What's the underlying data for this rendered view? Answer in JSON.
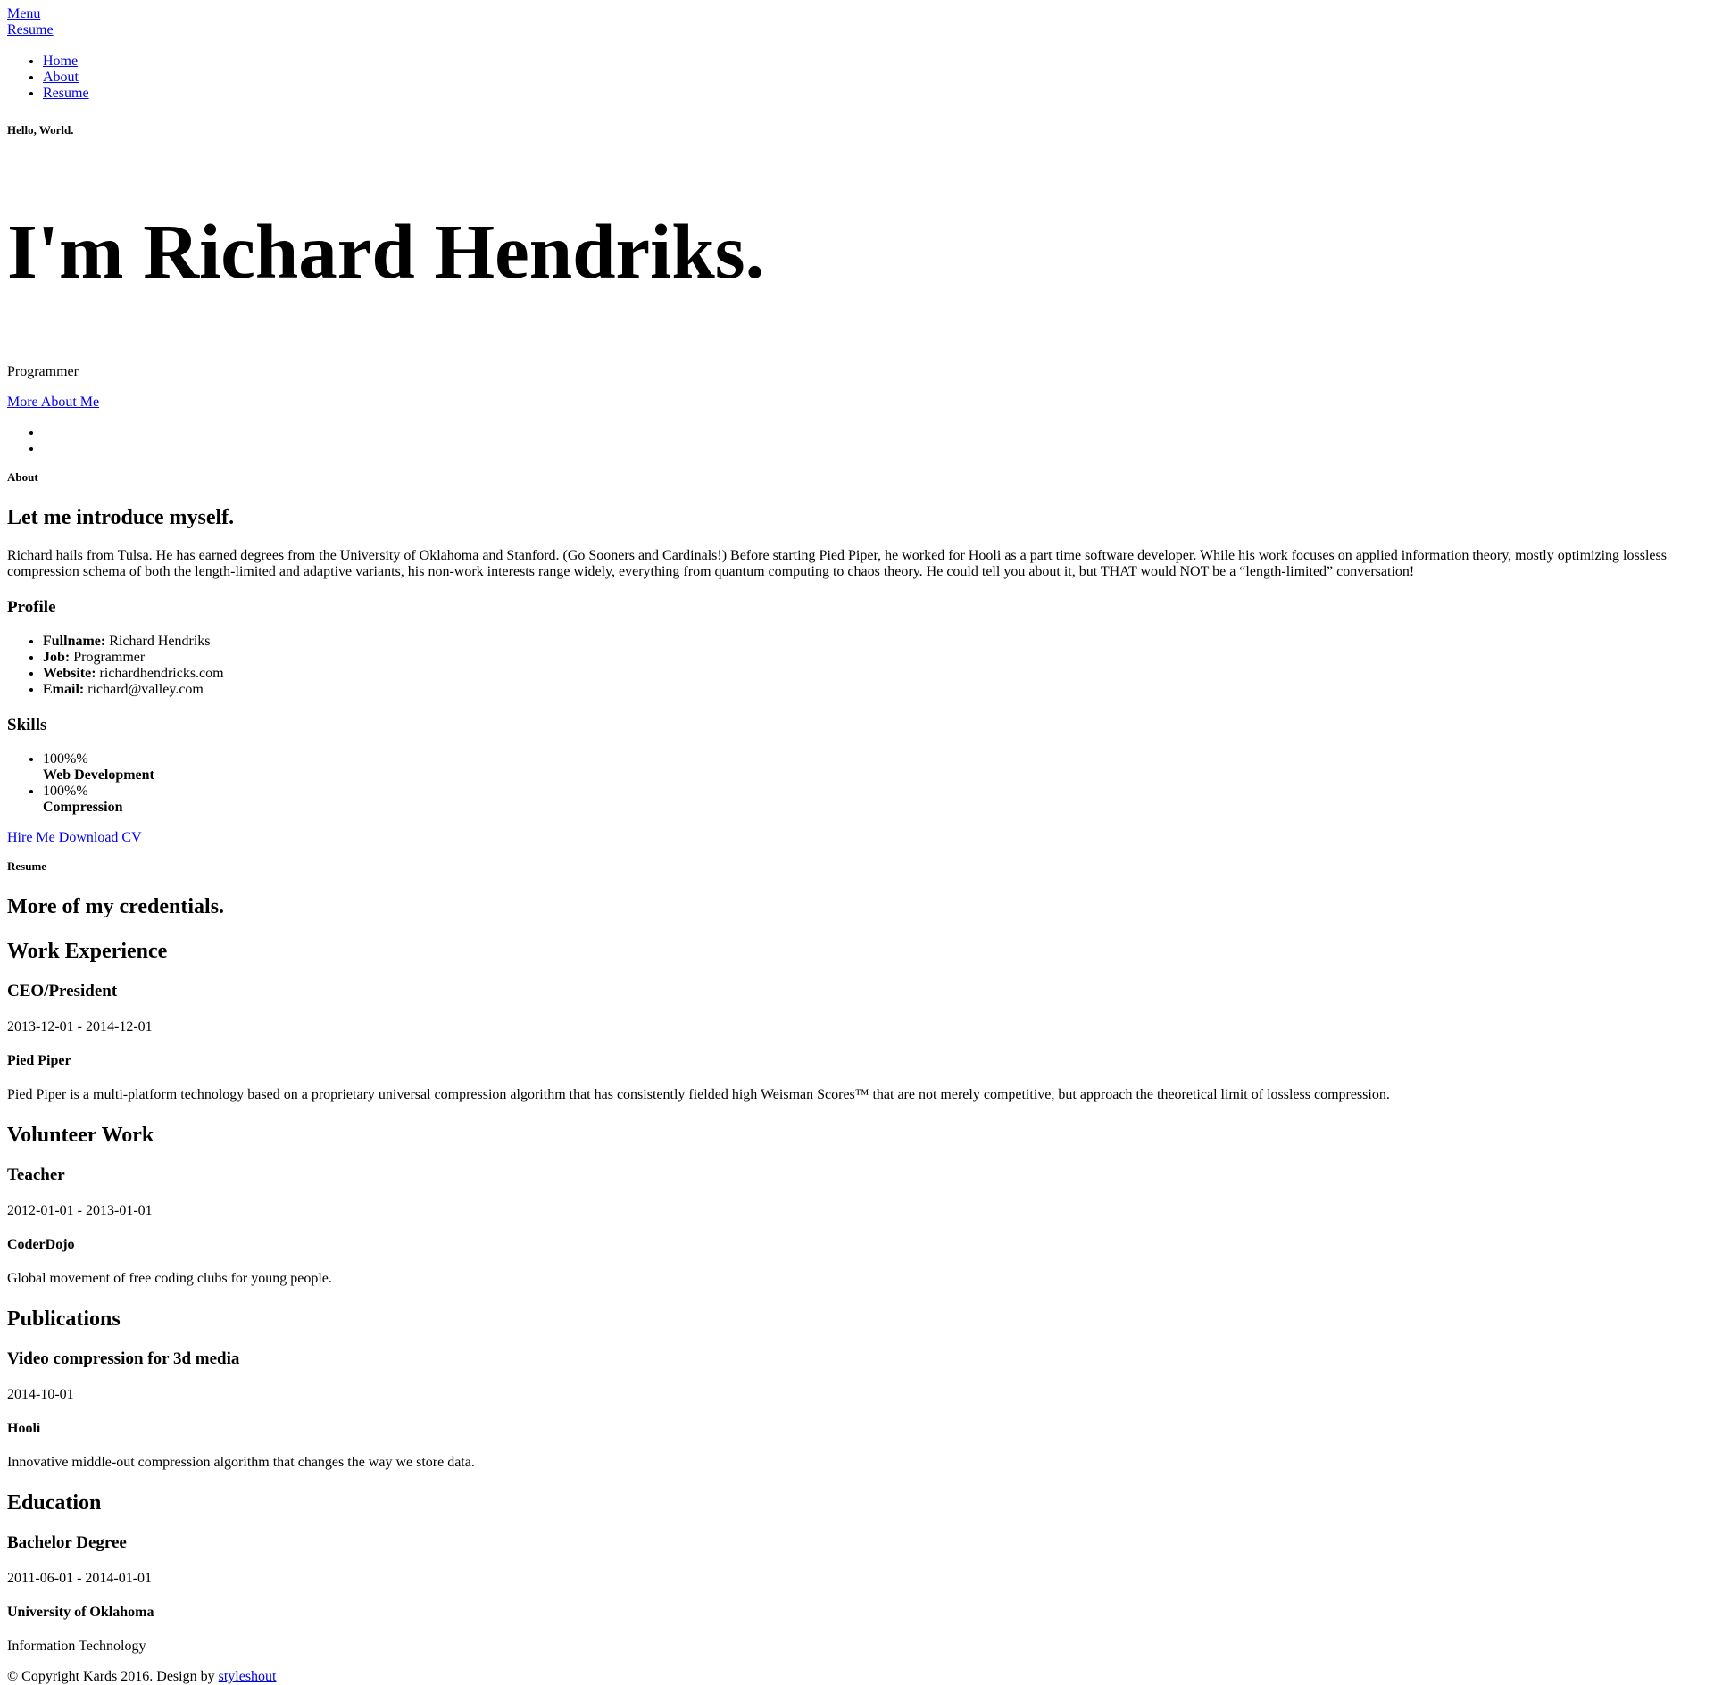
{
  "header": {
    "menu_label": "Menu",
    "resume_label": "Resume",
    "nav": [
      "Home",
      "About",
      "Resume"
    ]
  },
  "hero": {
    "greeting": "Hello, World.",
    "title": "I'm Richard Hendriks.",
    "job": "Programmer",
    "more_link": "More About Me"
  },
  "about": {
    "section_label": "About",
    "heading": "Let me introduce myself.",
    "bio": "Richard hails from Tulsa. He has earned degrees from the University of Oklahoma and Stanford. (Go Sooners and Cardinals!) Before starting Pied Piper, he worked for Hooli as a part time software developer. While his work focuses on applied information theory, mostly optimizing lossless compression schema of both the length-limited and adaptive variants, his non-work interests range widely, everything from quantum computing to chaos theory. He could tell you about it, but THAT would NOT be a “length-limited” conversation!",
    "profile_heading": "Profile",
    "profile": [
      {
        "label": "Fullname:",
        "value": "Richard Hendriks"
      },
      {
        "label": "Job:",
        "value": "Programmer"
      },
      {
        "label": "Website:",
        "value": "richardhendricks.com"
      },
      {
        "label": "Email:",
        "value": "richard@valley.com"
      }
    ],
    "skills_heading": "Skills",
    "skills": [
      {
        "percent": "100%%",
        "name": "Web Development"
      },
      {
        "percent": "100%%",
        "name": "Compression"
      }
    ],
    "hire_button": "Hire Me",
    "cv_button": "Download CV"
  },
  "resume": {
    "section_label": "Resume",
    "heading": "More of my credentials.",
    "work": {
      "heading": "Work Experience",
      "title": "CEO/President",
      "date": "2013-12-01 - 2014-12-01",
      "org": "Pied Piper",
      "desc": "Pied Piper is a multi-platform technology based on a proprietary universal compression algorithm that has consistently fielded high Weisman Scores™ that are not merely competitive, but approach the theoretical limit of lossless compression."
    },
    "volunteer": {
      "heading": "Volunteer Work",
      "title": "Teacher",
      "date": "2012-01-01 - 2013-01-01",
      "org": "CoderDojo",
      "desc": "Global movement of free coding clubs for young people."
    },
    "publications": {
      "heading": "Publications",
      "title": "Video compression for 3d media",
      "date": "2014-10-01",
      "org": "Hooli",
      "desc": "Innovative middle-out compression algorithm that changes the way we store data."
    },
    "education": {
      "heading": "Education",
      "title": "Bachelor Degree",
      "date": "2011-06-01 - 2014-01-01",
      "org": "University of Oklahoma",
      "desc": "Information Technology"
    }
  },
  "footer": {
    "text": "© Copyright Kards 2016. Design by ",
    "link": "styleshout"
  },
  "colors": {
    "link": "#0000ee",
    "text": "#000000",
    "background": "#ffffff"
  }
}
